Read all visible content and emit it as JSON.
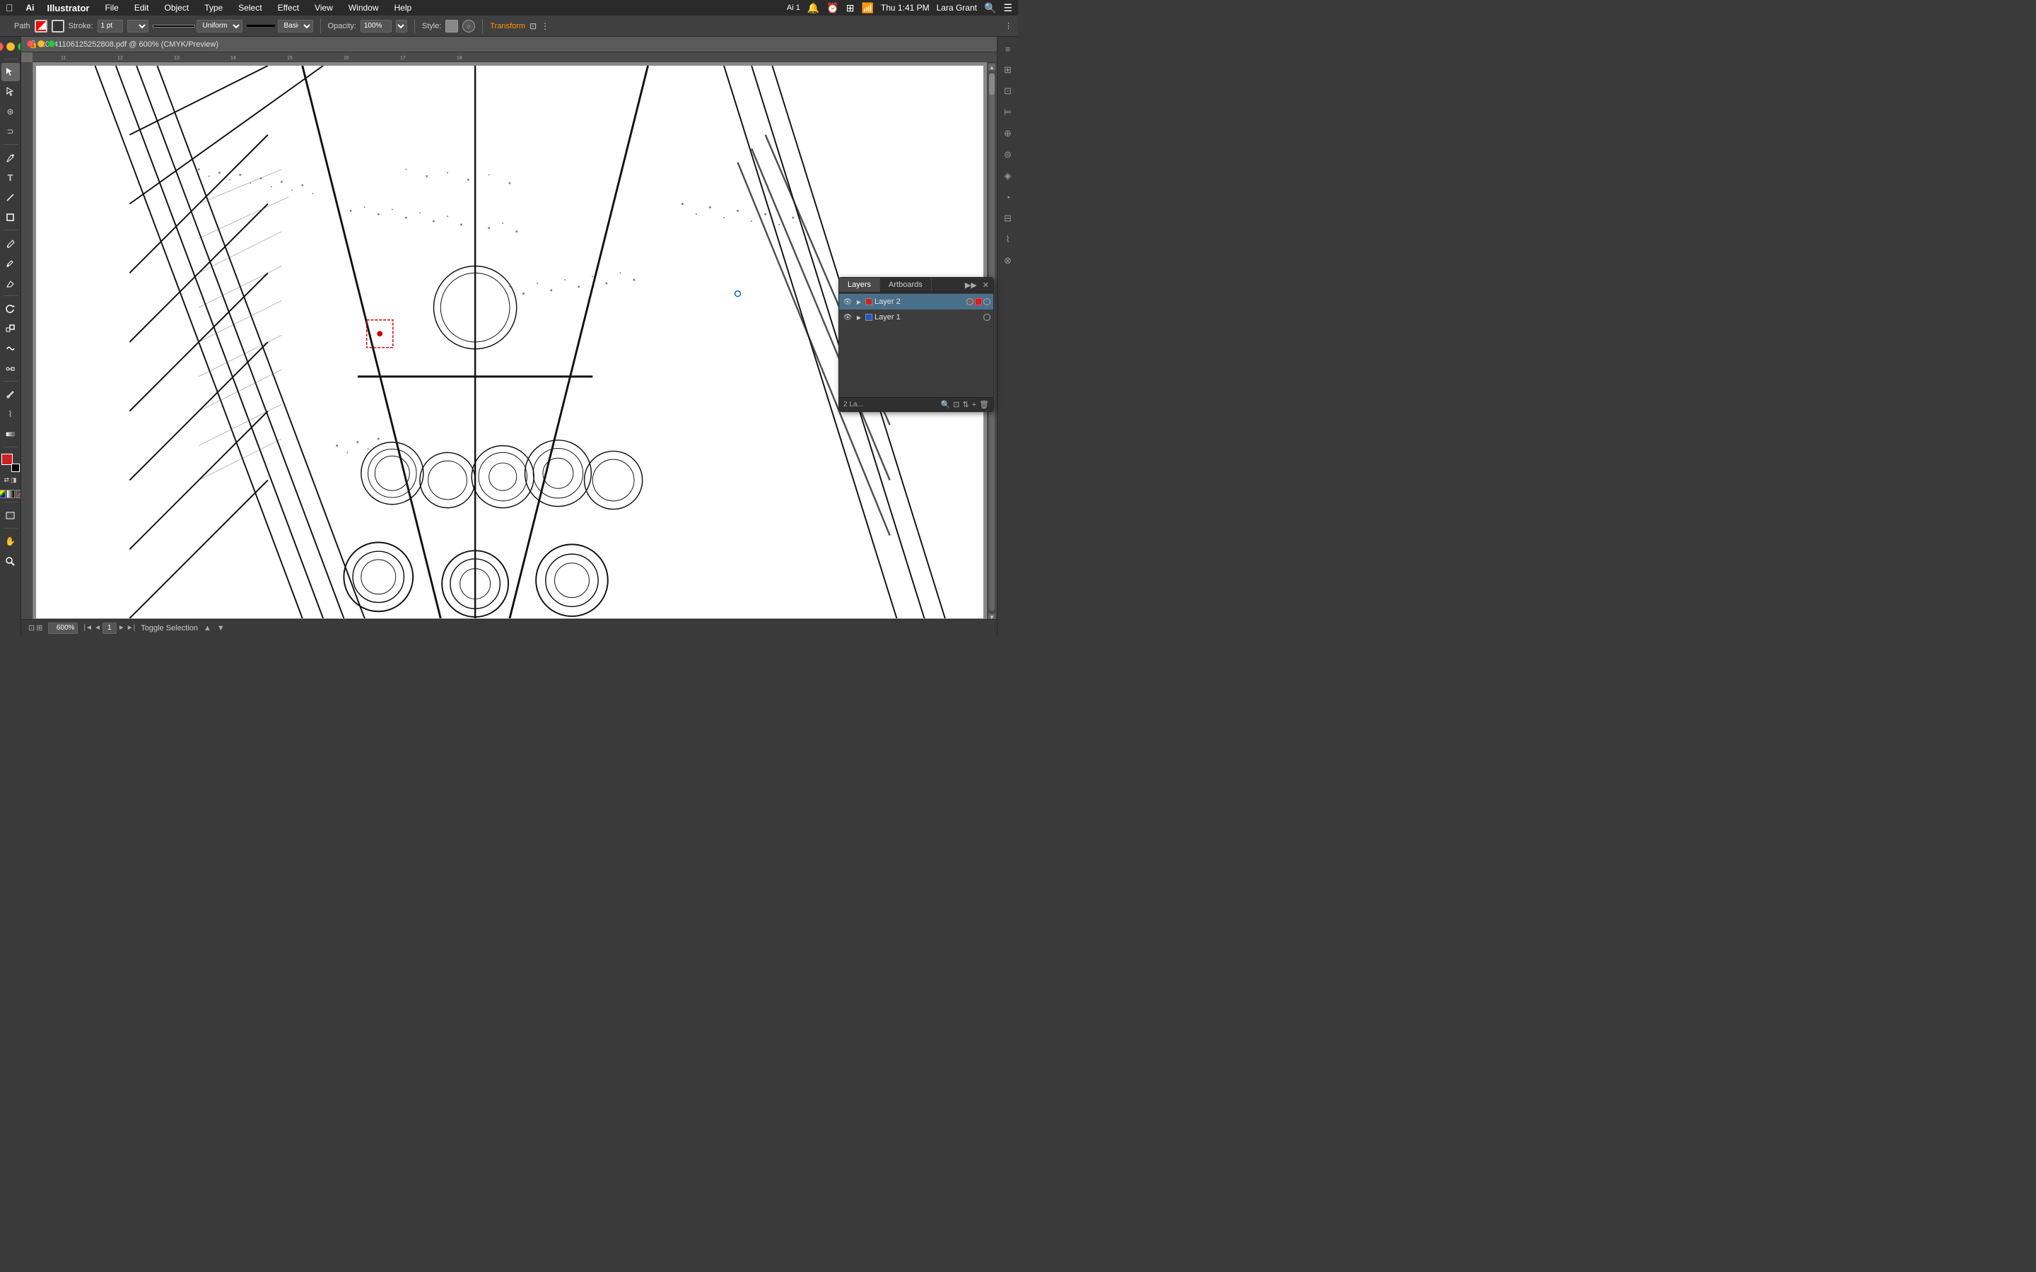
{
  "menubar": {
    "app_name": "Illustrator",
    "menus": [
      "File",
      "Edit",
      "Object",
      "Type",
      "Select",
      "Effect",
      "View",
      "Window",
      "Help"
    ],
    "right": {
      "battery_icon": "battery-icon",
      "wifi_icon": "wifi-icon",
      "time": "Thu 1:41 PM",
      "user": "Lara Grant",
      "ai_indicator": "Ai 1"
    }
  },
  "options_bar": {
    "label_path": "Path",
    "brush_icon": "brush-icon",
    "stroke_label": "Stroke:",
    "stroke_value": "1 pt",
    "stroke_style": "Uniform",
    "line_style": "Basic",
    "opacity_label": "Opacity:",
    "opacity_value": "100%",
    "style_label": "Style:",
    "transform_label": "Transform"
  },
  "document": {
    "title": "201411061252528​08.pdf @ 600% (CMYK/Preview)",
    "lock_icon": "lock-icon"
  },
  "layers_panel": {
    "tabs": [
      "Layers",
      "Artboards"
    ],
    "layers": [
      {
        "name": "Layer 2",
        "visible": true,
        "color": "#cc2222",
        "selected": true,
        "locked": false,
        "has_content": true
      },
      {
        "name": "Layer 1",
        "visible": true,
        "color": "#2255cc",
        "selected": false,
        "locked": false,
        "has_content": false
      }
    ],
    "footer": {
      "count_text": "2 La...",
      "search_icon": "search-icon",
      "new_layer_icon": "new-layer-icon",
      "move_selection_icon": "move-selection-icon",
      "duplicate_icon": "duplicate-icon",
      "delete_icon": "delete-icon"
    }
  },
  "status_bar": {
    "zoom_value": "600%",
    "page_value": "1",
    "toggle_label": "Toggle Selection",
    "nav_icons": [
      "prev-nav-icon",
      "next-nav-icon"
    ]
  },
  "tools": [
    {
      "name": "selection-tool",
      "icon": "↖",
      "label": "Selection"
    },
    {
      "name": "direct-selection-tool",
      "icon": "↗",
      "label": "Direct Selection"
    },
    {
      "name": "magic-wand-tool",
      "icon": "✦",
      "label": "Magic Wand"
    },
    {
      "name": "lasso-tool",
      "icon": "⊙",
      "label": "Lasso"
    },
    {
      "name": "pen-tool",
      "icon": "✒",
      "label": "Pen"
    },
    {
      "name": "type-tool",
      "icon": "T",
      "label": "Type"
    },
    {
      "name": "line-tool",
      "icon": "╲",
      "label": "Line"
    },
    {
      "name": "rectangle-tool",
      "icon": "□",
      "label": "Rectangle"
    },
    {
      "name": "paintbrush-tool",
      "icon": "⌇",
      "label": "Paintbrush"
    },
    {
      "name": "pencil-tool",
      "icon": "✏",
      "label": "Pencil"
    },
    {
      "name": "rotate-tool",
      "icon": "↻",
      "label": "Rotate"
    },
    {
      "name": "scale-tool",
      "icon": "⤡",
      "label": "Scale"
    },
    {
      "name": "blend-tool",
      "icon": "⊞",
      "label": "Blend"
    },
    {
      "name": "eyedropper-tool",
      "icon": "⌛",
      "label": "Eyedropper"
    },
    {
      "name": "gradient-tool",
      "icon": "◫",
      "label": "Gradient"
    },
    {
      "name": "hand-tool",
      "icon": "✋",
      "label": "Hand"
    },
    {
      "name": "zoom-tool",
      "icon": "⊕",
      "label": "Zoom"
    }
  ]
}
